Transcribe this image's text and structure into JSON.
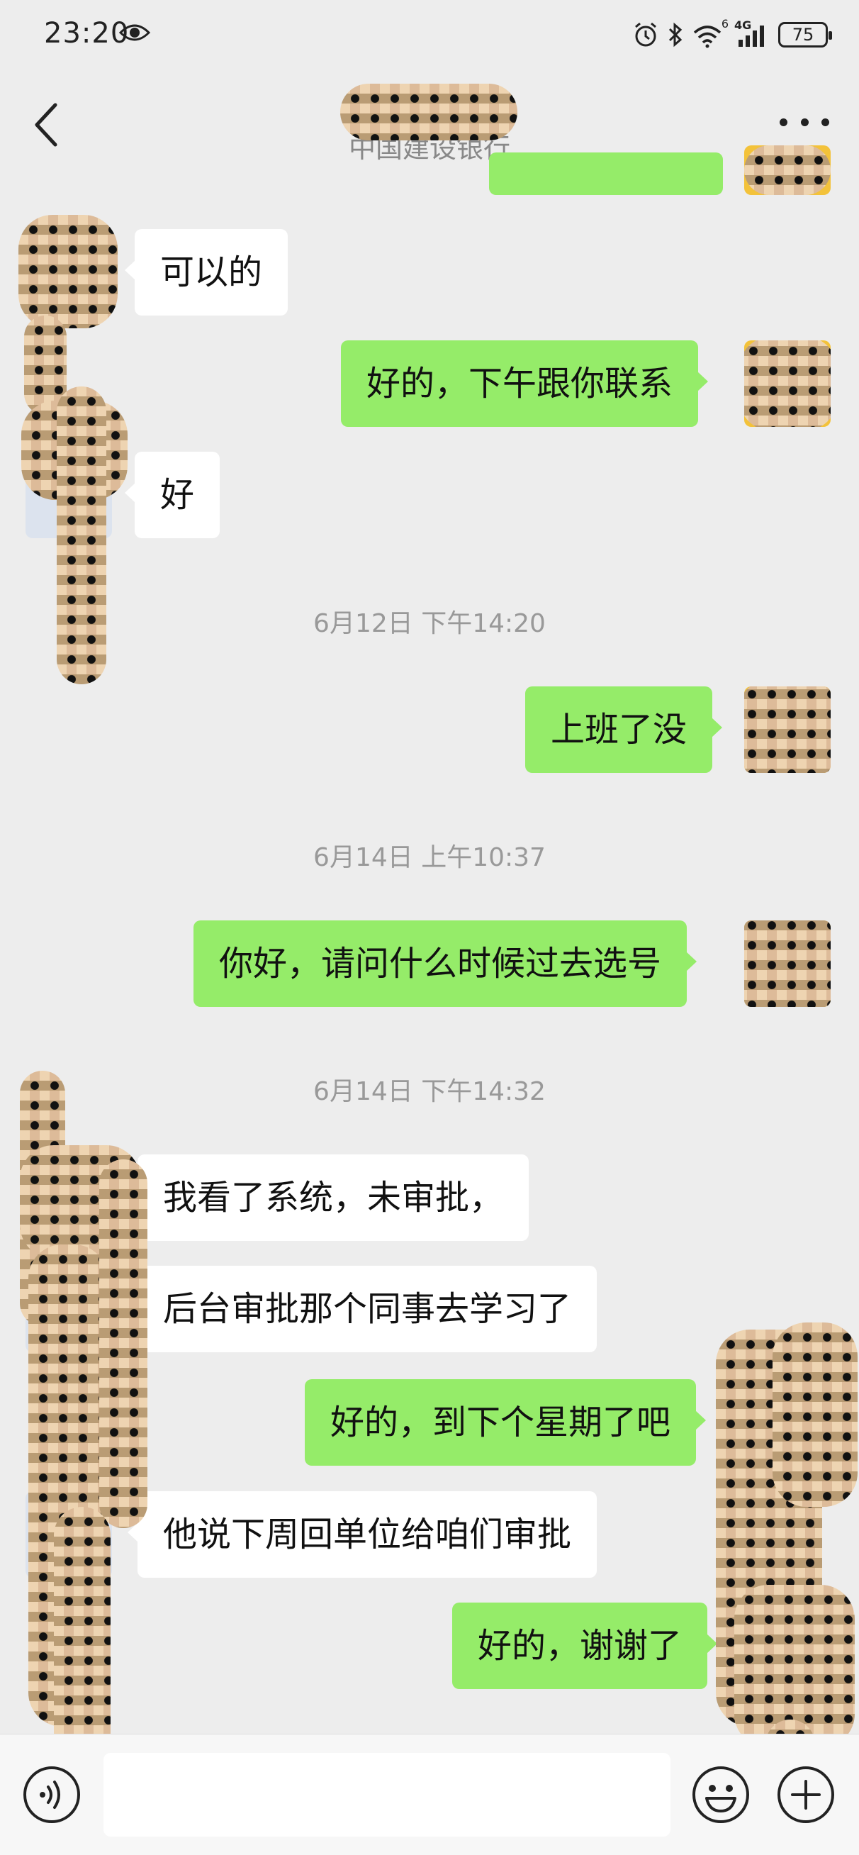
{
  "status_bar": {
    "time": "23:20",
    "battery_level": "75",
    "network_label": "4G",
    "wifi_badge": "6",
    "icons": [
      "eye-icon",
      "alarm-icon",
      "bluetooth-icon",
      "wifi-icon",
      "signal-icon",
      "battery-icon"
    ]
  },
  "header": {
    "title": "",
    "subtitle": "中国建设银行",
    "back_icon": "chevron-left-icon",
    "more_icon": "more-horizontal-icon"
  },
  "messages": [
    {
      "sender": "me",
      "text": ""
    },
    {
      "sender": "contact",
      "text": "可以的"
    },
    {
      "sender": "me",
      "text": "好的，下午跟你联系"
    },
    {
      "sender": "contact",
      "text": "好"
    },
    {
      "type": "timestamp",
      "text": "6月12日 下午14:20"
    },
    {
      "sender": "me",
      "text": "上班了没"
    },
    {
      "type": "timestamp",
      "text": "6月14日 上午10:37"
    },
    {
      "sender": "me",
      "text": "你好，请问什么时候过去选号"
    },
    {
      "type": "timestamp",
      "text": "6月14日 下午14:32"
    },
    {
      "sender": "contact",
      "text": "我看了系统，未审批，"
    },
    {
      "sender": "contact",
      "text": "后台审批那个同事去学习了"
    },
    {
      "sender": "me",
      "text": "好的，到下个星期了吧"
    },
    {
      "sender": "contact",
      "text": "他说下周回单位给咱们审批"
    },
    {
      "sender": "me",
      "text": "好的，谢谢了"
    }
  ],
  "input_bar": {
    "value": "",
    "placeholder": "",
    "voice_icon": "voice-icon",
    "emoji_icon": "emoji-icon",
    "plus_icon": "plus-circle-icon"
  },
  "colors": {
    "background": "#EDEDED",
    "outgoing_bubble": "#95EC69",
    "incoming_bubble": "#FFFFFF",
    "timestamp_text": "#999999"
  }
}
